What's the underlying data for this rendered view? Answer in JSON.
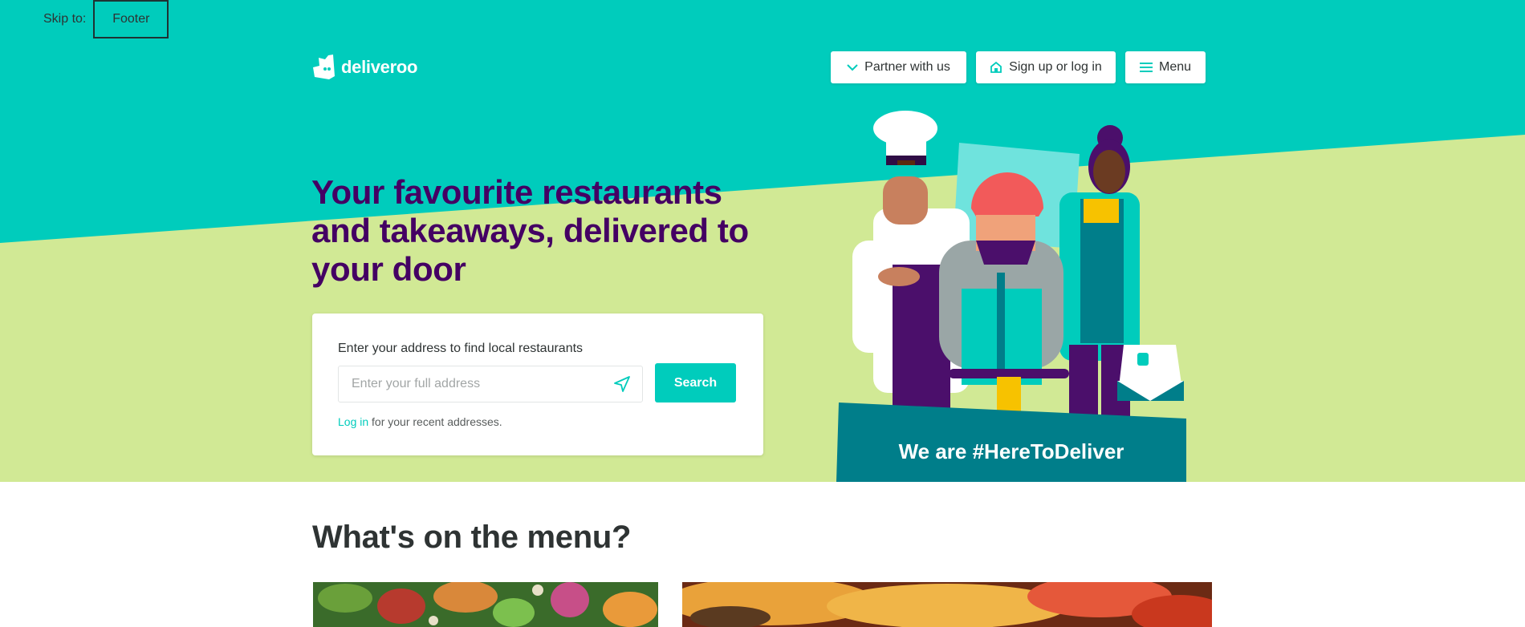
{
  "skip": {
    "label": "Skip to:",
    "footer": "Footer"
  },
  "brand": {
    "name": "deliveroo"
  },
  "header": {
    "partner_label": "Partner with us",
    "signup_label": "Sign up or log in",
    "menu_label": "Menu"
  },
  "hero": {
    "headline": "Your favourite restaurants and takeaways, delivered to your door",
    "banner": "We are #HereToDeliver"
  },
  "search": {
    "label": "Enter your address to find local restaurants",
    "placeholder": "Enter your full address",
    "value": "",
    "button": "Search",
    "login_link": "Log in",
    "login_hint": " for your recent addresses."
  },
  "menu_section": {
    "title": "What's on the menu?"
  },
  "icons": {
    "partner": "chevron-down-icon",
    "signup": "home-icon",
    "menu": "hamburger-icon",
    "location": "location-arrow-icon"
  },
  "colors": {
    "teal": "#00ccbc",
    "lime": "#d1e995",
    "purple": "#440063",
    "dark_teal": "#007e8a",
    "text": "#2e3333"
  }
}
